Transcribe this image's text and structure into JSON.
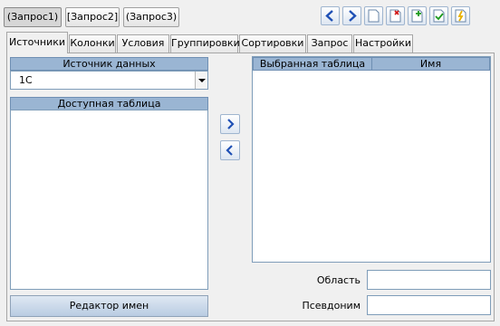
{
  "query_tabs": [
    "(Запрос1)",
    "[Запрос2]",
    "(Запрос3)"
  ],
  "toolbar_icons": [
    "arrow-left-icon",
    "arrow-right-icon",
    "new-document-icon",
    "delete-document-icon",
    "add-document-icon",
    "check-document-icon",
    "magic-wand-icon"
  ],
  "page_tabs": [
    "Источники",
    "Колонки",
    "Условия",
    "Группировки",
    "Сортировки",
    "Запрос",
    "Настройки"
  ],
  "source": {
    "header": "Источник данных",
    "value": "1С"
  },
  "available": {
    "header": "Доступная таблица"
  },
  "selected": {
    "col1": "Выбранная таблица",
    "col2": "Имя"
  },
  "fields": {
    "area_label": "Область",
    "area_value": "",
    "alias_label": "Псевдоним",
    "alias_value": ""
  },
  "name_editor_button": "Редактор имен",
  "colors": {
    "header_bg": "#9ab5d3",
    "arrow_blue": "#1f50b5"
  }
}
